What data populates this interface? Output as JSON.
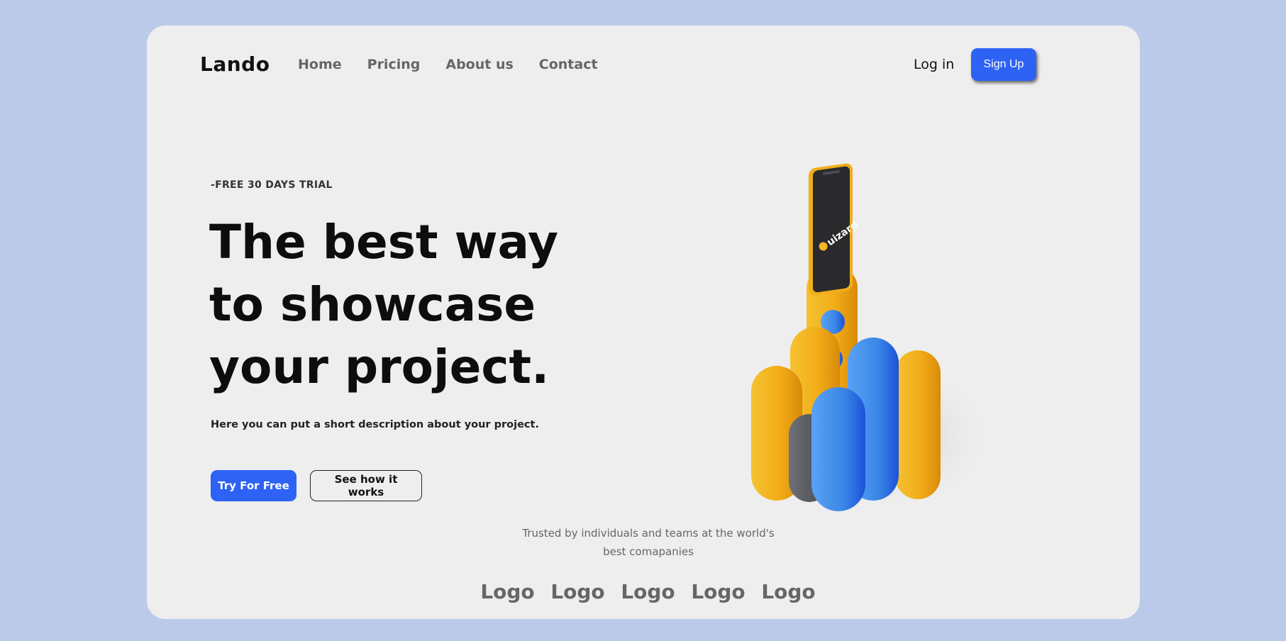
{
  "brand": "Lando",
  "nav": {
    "items": [
      "Home",
      "Pricing",
      "About us",
      "Contact"
    ],
    "login": "Log in",
    "signup": "Sign Up"
  },
  "hero": {
    "eyebrow": "-FREE 30 DAYS TRIAL",
    "headline": [
      "The best way",
      "to showcase",
      "your project."
    ],
    "description": "Here you can put a short description about your project.",
    "primary_button": "Try For Free",
    "secondary_button": "See how it works",
    "phone_brand": "uizard"
  },
  "trusted": {
    "text_line1": "Trusted by individuals and teams at the world's",
    "text_line2": "best comapanies",
    "logos": [
      "Logo",
      "Logo",
      "Logo",
      "Logo",
      "Logo"
    ]
  },
  "colors": {
    "page_background": "#bccaea",
    "card_background": "#eeeeee",
    "accent_blue": "#2e62f5",
    "illustration_yellow": "#f2b01e",
    "illustration_blue": "#3a8ae8",
    "illustration_gray": "#5a5d63"
  }
}
